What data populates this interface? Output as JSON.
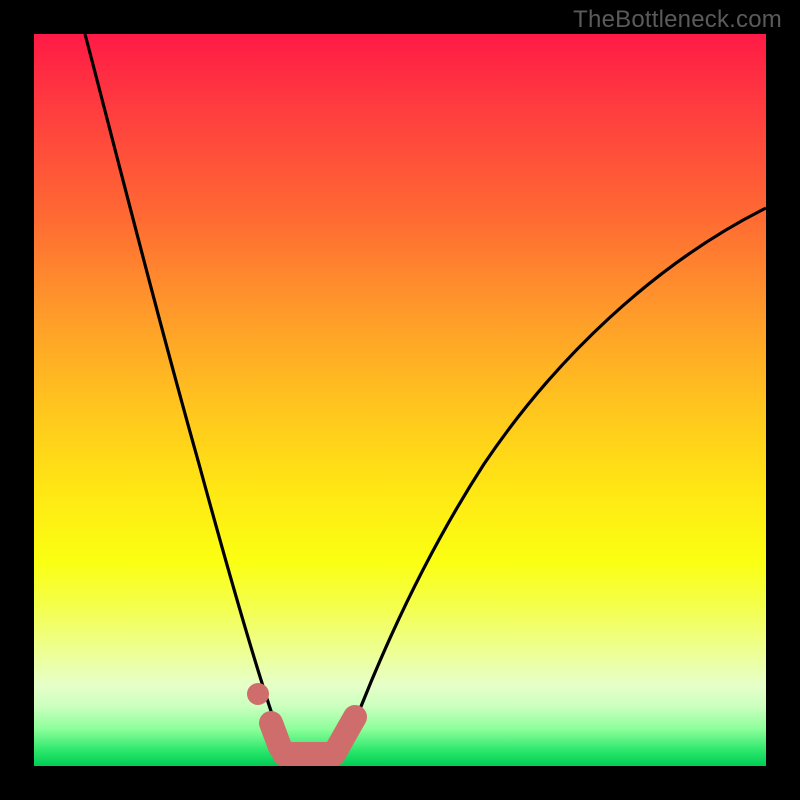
{
  "watermark": "TheBottleneck.com",
  "colors": {
    "frame": "#000000",
    "curve": "#000000",
    "marker": "#cf6d6c"
  },
  "chart_data": {
    "type": "line",
    "title": "",
    "xlabel": "",
    "ylabel": "",
    "xlim": [
      0,
      100
    ],
    "ylim": [
      0,
      100
    ],
    "grid": false,
    "series": [
      {
        "name": "bottleneck-curve",
        "x": [
          7,
          10,
          14,
          18,
          22,
          26,
          29,
          31,
          33,
          35,
          37,
          39,
          42,
          46,
          52,
          60,
          70,
          82,
          94,
          100
        ],
        "y": [
          100,
          85,
          68,
          53,
          39,
          26,
          16,
          10,
          5,
          2,
          1,
          2,
          5,
          11,
          21,
          33,
          45,
          56,
          64,
          68
        ]
      }
    ],
    "markers": [
      {
        "shape": "dot",
        "x": 30.5,
        "y": 10.0,
        "size": 1.6
      },
      {
        "shape": "capsule",
        "x0": 32.3,
        "y0": 6.0,
        "x1": 33.5,
        "y1": 2.4
      },
      {
        "shape": "capsule",
        "x0": 34.0,
        "y0": 1.4,
        "x1": 40.8,
        "y1": 1.8
      },
      {
        "shape": "capsule",
        "x0": 40.8,
        "y0": 1.8,
        "x1": 43.8,
        "y1": 6.8
      }
    ]
  }
}
